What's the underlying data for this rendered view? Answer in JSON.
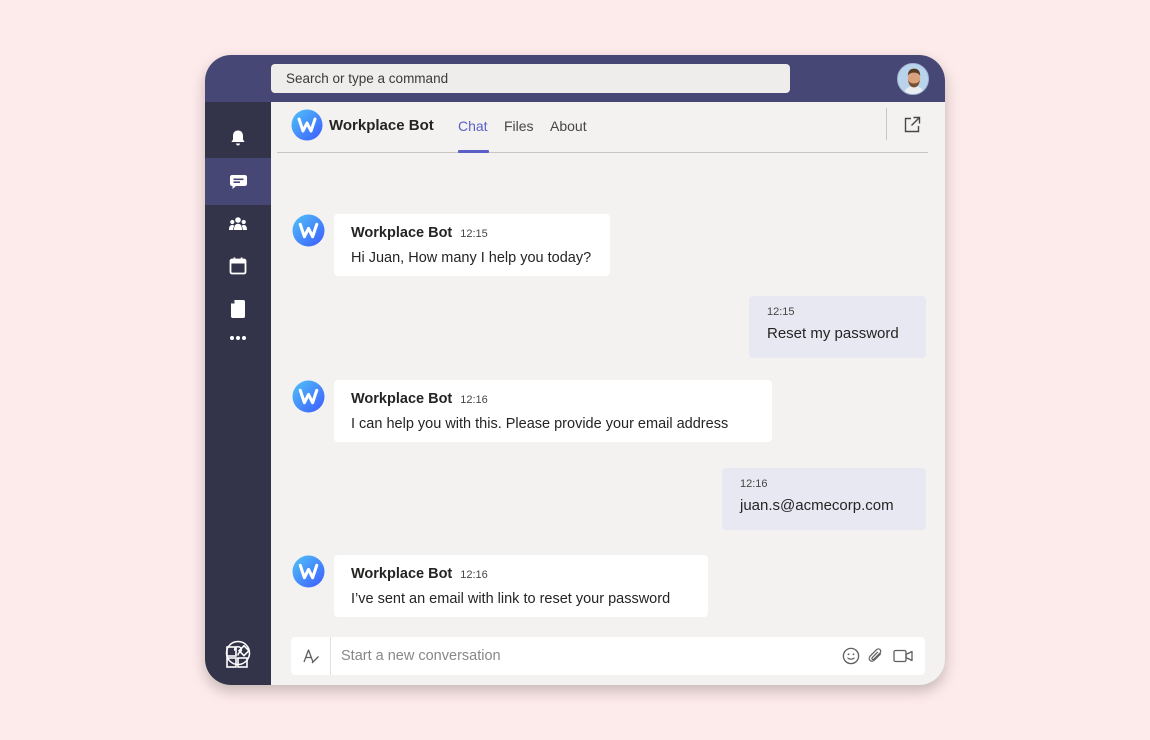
{
  "search": {
    "placeholder": "Search or type a command"
  },
  "rail": {
    "items": [
      {
        "name": "activity",
        "icon": "bell-icon",
        "active": false
      },
      {
        "name": "chat",
        "icon": "chat-icon",
        "active": true
      },
      {
        "name": "teams",
        "icon": "teams-icon",
        "active": false
      },
      {
        "name": "calendar",
        "icon": "calendar-icon",
        "active": false
      },
      {
        "name": "files",
        "icon": "file-icon",
        "active": false
      },
      {
        "name": "more",
        "icon": "more-icon",
        "active": false
      }
    ],
    "bottom": [
      {
        "name": "apps",
        "icon": "apps-icon"
      },
      {
        "name": "help",
        "icon": "help-icon"
      }
    ]
  },
  "header": {
    "bot_name": "Workplace Bot",
    "tabs": [
      {
        "label": "Chat",
        "active": true
      },
      {
        "label": "Files",
        "active": false
      },
      {
        "label": "About",
        "active": false
      }
    ]
  },
  "messages": [
    {
      "from": "bot",
      "sender": "Workplace Bot",
      "time": "12:15",
      "text": "Hi Juan, How many I help you today?"
    },
    {
      "from": "user",
      "time": "12:15",
      "text": "Reset my password"
    },
    {
      "from": "bot",
      "sender": "Workplace Bot",
      "time": "12:16",
      "text": "I can help you with this. Please provide your email address"
    },
    {
      "from": "user",
      "time": "12:16",
      "text": "juan.s@acmecorp.com"
    },
    {
      "from": "bot",
      "sender": "Workplace Bot",
      "time": "12:16",
      "text": "I’ve sent an email with link to reset your password"
    }
  ],
  "composer": {
    "placeholder": "Start a new conversation"
  },
  "colors": {
    "accent": "#5b5fc7",
    "topbar": "#464775",
    "rail": "#33344a",
    "user_bubble": "#e8e8f3"
  }
}
